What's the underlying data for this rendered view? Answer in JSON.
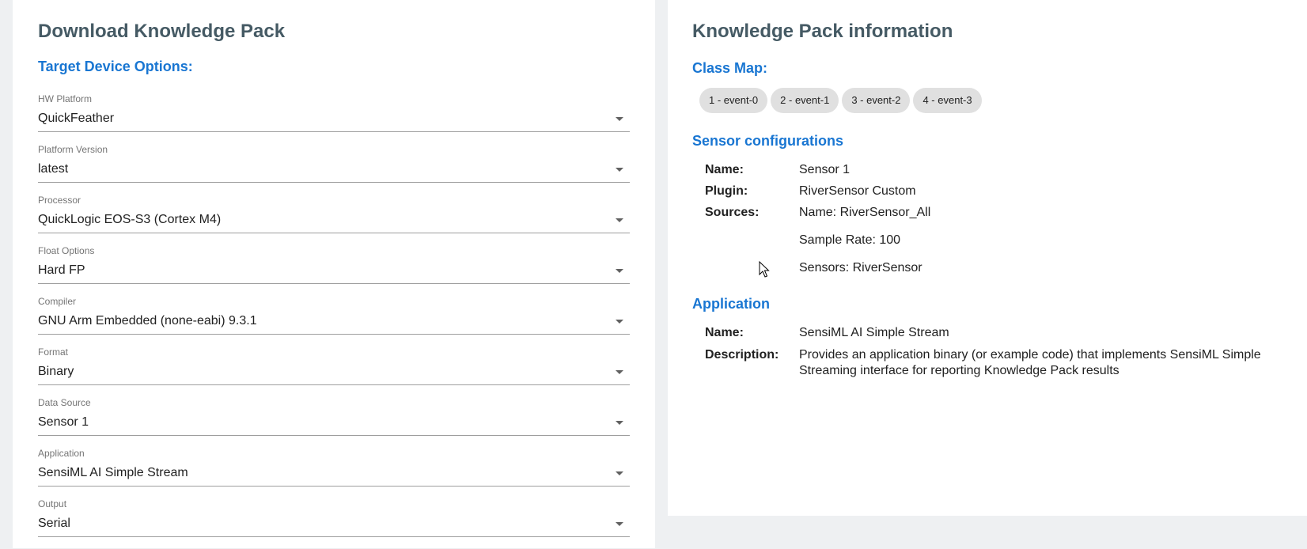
{
  "download_panel": {
    "title": "Download Knowledge Pack",
    "section_title": "Target Device Options:",
    "fields": [
      {
        "label": "HW Platform",
        "value": "QuickFeather"
      },
      {
        "label": "Platform Version",
        "value": "latest"
      },
      {
        "label": "Processor",
        "value": "QuickLogic EOS-S3 (Cortex M4)"
      },
      {
        "label": "Float Options",
        "value": "Hard FP"
      },
      {
        "label": "Compiler",
        "value": "GNU Arm Embedded (none-eabi) 9.3.1"
      },
      {
        "label": "Format",
        "value": "Binary"
      },
      {
        "label": "Data Source",
        "value": "Sensor 1"
      },
      {
        "label": "Application",
        "value": "SensiML AI Simple Stream"
      },
      {
        "label": "Output",
        "value": "Serial"
      }
    ]
  },
  "info_panel": {
    "title": "Knowledge Pack information",
    "class_map": {
      "title": "Class Map:",
      "chips": [
        "1 - event-0",
        "2 - event-1",
        "3 - event-2",
        "4 - event-3"
      ]
    },
    "sensor_configurations": {
      "title": "Sensor configurations",
      "name_label": "Name:",
      "name_value": "Sensor 1",
      "plugin_label": "Plugin:",
      "plugin_value": "RiverSensor Custom",
      "sources_label": "Sources:",
      "sources_name": "Name: RiverSensor_All",
      "sources_sample_rate": "Sample Rate: 100",
      "sources_sensors": "Sensors: RiverSensor"
    },
    "application": {
      "title": "Application",
      "name_label": "Name:",
      "name_value": "SensiML AI Simple Stream",
      "description_label": "Description:",
      "description_value": "Provides an application binary (or example code) that implements SensiML Simple Streaming interface for reporting Knowledge Pack results"
    }
  },
  "colors": {
    "accent": "#1976d2",
    "title": "#455a64",
    "chip_bg": "#e0e0e0",
    "page_bg": "#eef0f2"
  }
}
